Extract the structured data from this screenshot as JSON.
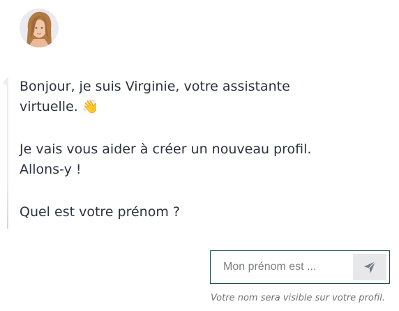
{
  "assistant": {
    "name": "Virginie",
    "avatar_icon": "assistant-avatar-photo"
  },
  "message": {
    "paragraph1_line1": "Bonjour, je suis Virginie, votre assistante",
    "paragraph1_line2": "virtuelle.",
    "paragraph1_emoji": "👋",
    "paragraph2_line1": "Je vais vous aider à créer un nouveau profil.",
    "paragraph2_line2": "Allons-y !",
    "paragraph3": "Quel est votre prénom ?"
  },
  "input": {
    "placeholder": "Mon prénom est ...",
    "value": "",
    "send_icon": "send-icon"
  },
  "hint": "Votre nom sera visible sur votre profil.",
  "colors": {
    "text": "#2b3240",
    "input_border": "#1f4d46",
    "send_button_bg": "#e6e8ea",
    "send_icon": "#6f7a85",
    "hint_text": "#6e7379"
  }
}
